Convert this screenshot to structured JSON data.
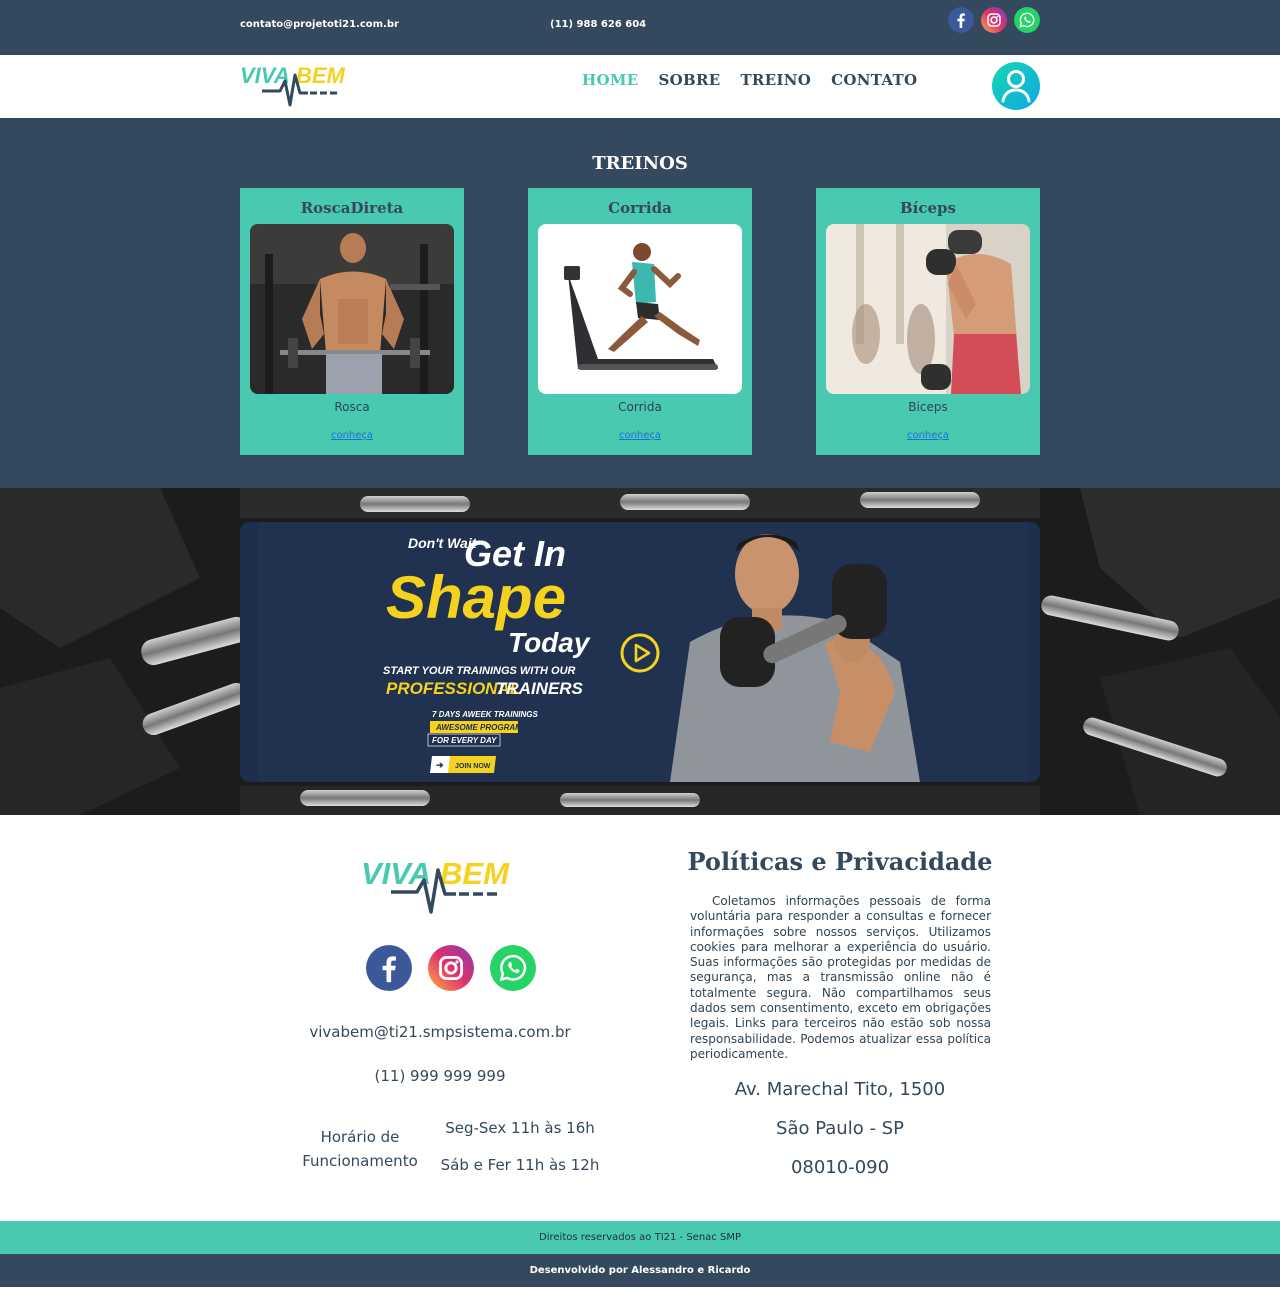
{
  "topbar": {
    "email": "contato@projetoti21.com.br",
    "phone": "(11) 988 626 604",
    "socials": [
      "facebook-icon",
      "instagram-icon",
      "whatsapp-icon"
    ]
  },
  "header": {
    "logo_text_left": "VIVA",
    "logo_text_right": "BEM",
    "nav": [
      {
        "label": "HOME",
        "active": true
      },
      {
        "label": "SOBRE",
        "active": false
      },
      {
        "label": "TREINO",
        "active": false
      },
      {
        "label": "CONTATO",
        "active": false
      }
    ],
    "user_icon": "user-icon"
  },
  "treinos": {
    "title": "TREINOS",
    "cards": [
      {
        "title": "RoscaDireta",
        "caption": "Rosca",
        "link": "conheça"
      },
      {
        "title": "Corrida",
        "caption": "Corrida",
        "link": "conheça"
      },
      {
        "title": "Bíceps",
        "caption": "Biceps",
        "link": "conheça"
      }
    ]
  },
  "banner": {
    "line1a": "Don't Wait",
    "line1b": "Get In",
    "line2": "Shape",
    "line3": "Today",
    "sub1": "START YOUR TRAININGS WITH OUR",
    "sub2a": "PROFESSIONAL",
    "sub2b": "TRAINERS",
    "tag1": "7 DAYS AWEEK TRAININGS",
    "tag2": "AWESOME PROGRAMS",
    "tag3": "FOR EVERY DAY",
    "cta": "JOIN NOW"
  },
  "footer": {
    "email": "vivabem@ti21.smpsistema.com.br",
    "phone": "(11) 999 999 999",
    "hours_label": "Horário de Funcionamento",
    "hours1": "Seg-Sex 11h às 16h",
    "hours2": "Sáb e Fer 11h às 12h",
    "policy_title": "Políticas e Privacidade",
    "policy_text": "Coletamos informações pessoais de forma voluntária para responder a consultas e fornecer informações sobre nossos serviços. Utilizamos cookies para melhorar a experiência do usuário. Suas informações são protegidas por medidas de segurança, mas a transmissão online não é totalmente segura. Não compartilhamos seus dados sem consentimento, exceto em obrigações legais. Links para terceiros não estão sob nossa responsabilidade. Podemos atualizar essa política periodicamente.",
    "address": "Av. Marechal Tito, 1500",
    "city": "São Paulo - SP",
    "cep": "08010-090"
  },
  "bottom": {
    "copyright": "Direitos reservados ao TI21 - Senac SMP",
    "developed": "Desenvolvido por Alessandro e Ricardo"
  },
  "colors": {
    "navy": "#34495e",
    "teal": "#48c9b0",
    "yellow": "#f4d21f"
  }
}
